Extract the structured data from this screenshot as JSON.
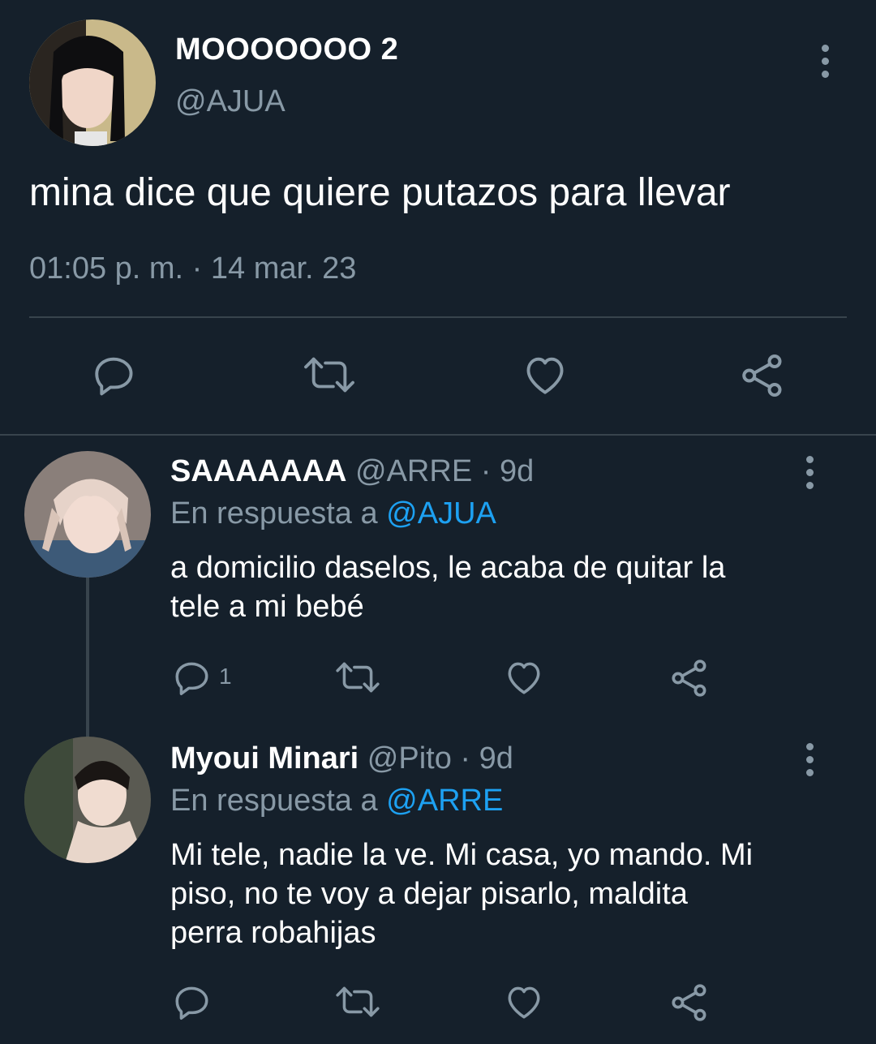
{
  "main_tweet": {
    "display_name": "MOOOOOOO 2",
    "handle": "@AJUA",
    "text": "mina dice que quiere putazos para llevar",
    "timestamp": "01:05 p. m. · 14 mar. 23",
    "actions": [
      "reply-icon",
      "retweet-icon",
      "like-icon",
      "share-icon"
    ]
  },
  "replies": [
    {
      "display_name": "SAAAAAAA",
      "handle": "@ARRE",
      "time": "· 9d",
      "reply_prefix": "En respuesta a",
      "reply_to": "@AJUA",
      "text_lines": [
        "a domicilio daselos, le acaba de quitar la",
        "tele a mi bebé"
      ],
      "reply_count": "1"
    },
    {
      "display_name": "Myoui Minari",
      "handle": "@Pito",
      "time": "· 9d",
      "reply_prefix": "En respuesta a",
      "reply_to": "@ARRE",
      "text_lines": [
        "Mi tele, nadie la ve. Mi casa, yo mando. Mi",
        "piso, no te voy a dejar pisarlo, maldita",
        "perra robahijas"
      ],
      "reply_count": ""
    }
  ],
  "colors": {
    "background": "#15202b",
    "muted": "#8899a6",
    "accent": "#1da1f2",
    "divider": "#38444d"
  }
}
